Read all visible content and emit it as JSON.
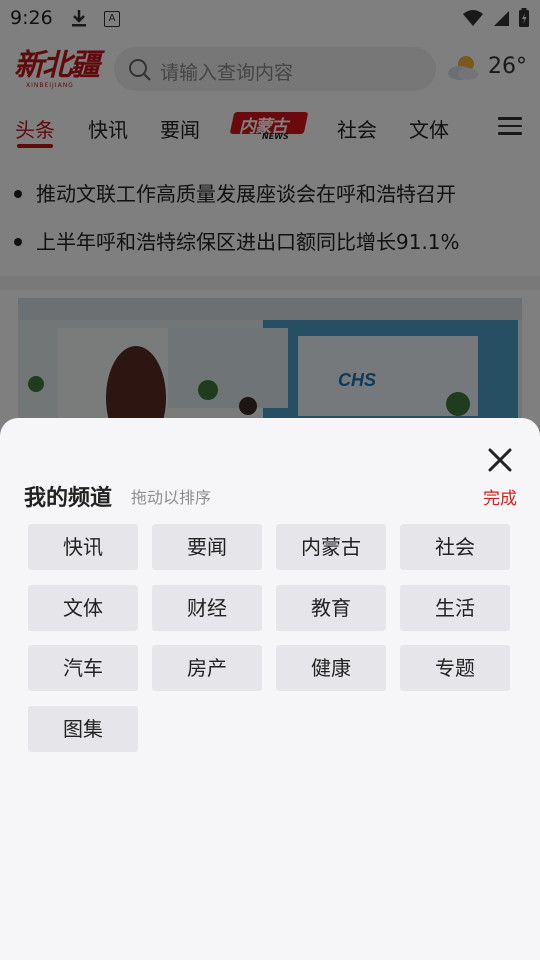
{
  "status": {
    "time": "9:26",
    "a_icon": "A"
  },
  "header": {
    "logo_text": "新北疆",
    "logo_sub": "XINBEIJIANG",
    "search_placeholder": "请输入查询内容",
    "temperature": "26°"
  },
  "tabs": {
    "items": [
      "头条",
      "快讯",
      "要闻",
      "社会",
      "文体"
    ],
    "special": {
      "label": "内蒙古",
      "sub": "NEWS"
    }
  },
  "headlines": [
    "推动文联工作高质量发展座谈会在呼和浩特召开",
    "上半年呼和浩特综保区进出口额同比增长91.1%"
  ],
  "photo": {
    "sign_text": "CHS"
  },
  "channel_sheet": {
    "title": "我的频道",
    "hint": "拖动以排序",
    "done_label": "完成",
    "channels": [
      "快讯",
      "要闻",
      "内蒙古",
      "社会",
      "文体",
      "财经",
      "教育",
      "生活",
      "汽车",
      "房产",
      "健康",
      "专题",
      "图集"
    ]
  },
  "colors": {
    "accent": "#c2141b",
    "done": "#d4221c",
    "overlay": "rgba(0,0,0,0.5)"
  }
}
